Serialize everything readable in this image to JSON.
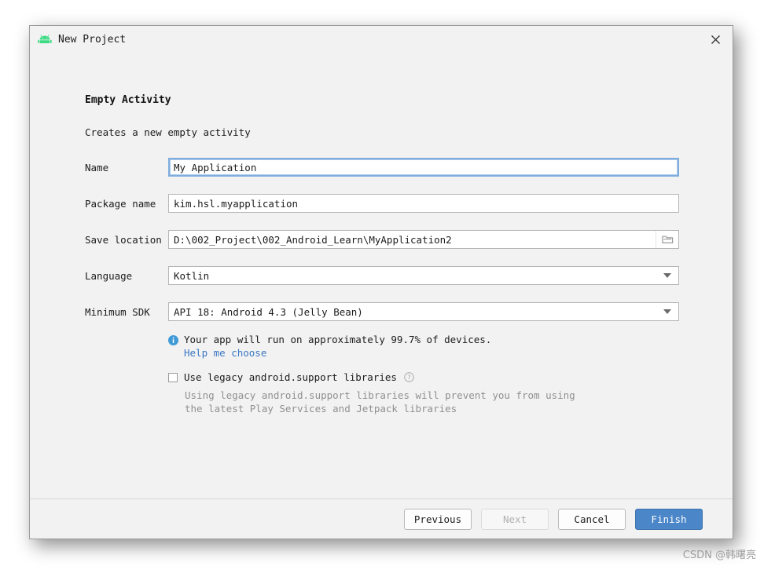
{
  "window": {
    "title": "New Project",
    "icon": "android-robot-icon",
    "close_label": "×"
  },
  "wizard": {
    "step_title": "Empty Activity",
    "step_description": "Creates a new empty activity"
  },
  "form": {
    "fields": [
      {
        "label": "Name",
        "value": "My Application",
        "type": "text",
        "focused": true
      },
      {
        "label": "Package name",
        "value": "kim.hsl.myapplication",
        "type": "text",
        "focused": false
      },
      {
        "label": "Save location",
        "value": "D:\\002_Project\\002_Android_Learn\\MyApplication2",
        "type": "text-browse",
        "focused": false,
        "browse_icon": "folder-icon"
      },
      {
        "label": "Language",
        "value": "Kotlin",
        "type": "combo",
        "focused": false
      },
      {
        "label": "Minimum SDK",
        "value": "API 18: Android 4.3 (Jelly Bean)",
        "type": "combo",
        "focused": false
      }
    ]
  },
  "info": {
    "icon": "info-icon",
    "message": "Your app will run on approximately 99.7% of devices.",
    "link_text": "Help me choose",
    "percent": "99.7%"
  },
  "legacy": {
    "checked": false,
    "label": "Use legacy android.support libraries",
    "help_icon": "question-mark-icon",
    "description_line1": "Using legacy android.support libraries will prevent you from using",
    "description_line2": "the latest Play Services and Jetpack libraries"
  },
  "footer": {
    "buttons": [
      {
        "label": "Previous",
        "state": "enabled",
        "primary": false
      },
      {
        "label": "Next",
        "state": "disabled",
        "primary": false
      },
      {
        "label": "Cancel",
        "state": "enabled",
        "primary": false
      },
      {
        "label": "Finish",
        "state": "enabled",
        "primary": true
      }
    ]
  },
  "watermark": {
    "text": "CSDN @韩曙亮"
  },
  "colors": {
    "dialog_bg": "#f2f2f2",
    "field_bg": "#ffffff",
    "focus_border": "#7fadde",
    "link": "#3a77c2",
    "primary_button": "#4a86c8",
    "android_green": "#3ddc84",
    "info_blue": "#3f9ad6"
  }
}
